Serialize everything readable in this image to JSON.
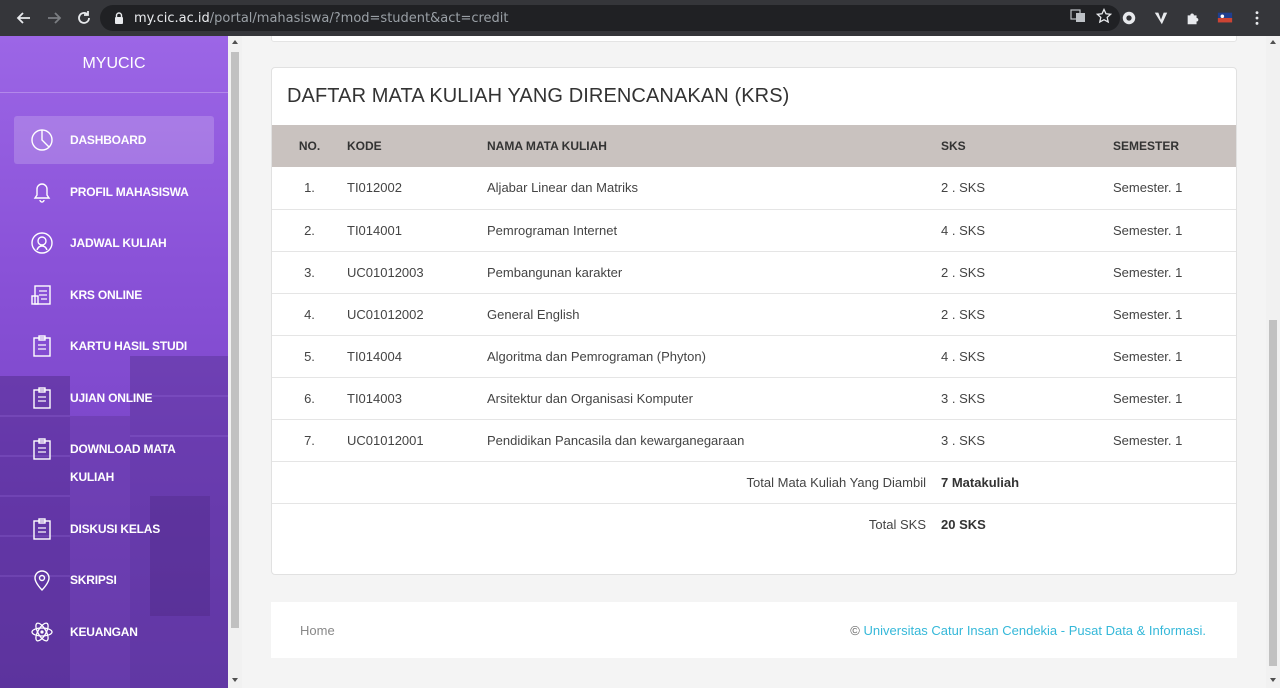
{
  "browser": {
    "url_host": "my.cic.ac.id",
    "url_path": "/portal/mahasiswa/?mod=student&act=credit"
  },
  "sidebar": {
    "brand": "MYUCIC",
    "items": [
      {
        "label": "DASHBOARD",
        "icon": "pie-chart-icon",
        "active": true
      },
      {
        "label": "PROFIL MAHASISWA",
        "icon": "bell-icon"
      },
      {
        "label": "JADWAL KULIAH",
        "icon": "user-circle-icon"
      },
      {
        "label": "KRS ONLINE",
        "icon": "document-icon"
      },
      {
        "label": "KARTU HASIL STUDI",
        "icon": "clipboard-icon"
      },
      {
        "label": "UJIAN ONLINE",
        "icon": "clipboard-icon"
      },
      {
        "label": "DOWNLOAD MATA KULIAH",
        "icon": "clipboard-icon"
      },
      {
        "label": "DISKUSI KELAS",
        "icon": "clipboard-icon"
      },
      {
        "label": "SKRIPSI",
        "icon": "map-pin-icon"
      },
      {
        "label": "KEUANGAN",
        "icon": "atom-icon"
      }
    ]
  },
  "main": {
    "title": "DAFTAR MATA KULIAH YANG DIRENCANAKAN (KRS)",
    "table": {
      "headers": [
        "NO.",
        "KODE",
        "NAMA MATA KULIAH",
        "SKS",
        "SEMESTER"
      ],
      "rows": [
        [
          "1.",
          "TI012002",
          "Aljabar Linear dan Matriks",
          "2 . SKS",
          "Semester. 1"
        ],
        [
          "2.",
          "TI014001",
          "Pemrograman Internet",
          "4 . SKS",
          "Semester. 1"
        ],
        [
          "3.",
          "UC01012003",
          "Pembangunan karakter",
          "2 . SKS",
          "Semester. 1"
        ],
        [
          "4.",
          "UC01012002",
          "General English",
          "2 . SKS",
          "Semester. 1"
        ],
        [
          "5.",
          "TI014004",
          "Algoritma dan Pemrograman (Phyton)",
          "4 . SKS",
          "Semester. 1"
        ],
        [
          "6.",
          "TI014003",
          "Arsitektur dan Organisasi Komputer",
          "3 . SKS",
          "Semester. 1"
        ],
        [
          "7.",
          "UC01012001",
          "Pendidikan Pancasila dan kewarganegaraan",
          "3 . SKS",
          "Semester. 1"
        ]
      ],
      "total_mk_label": "Total Mata Kuliah Yang Diambil",
      "total_mk_value": "7 Matakuliah",
      "total_sks_label": "Total SKS",
      "total_sks_value": "20 SKS"
    }
  },
  "footer": {
    "home": "Home",
    "copyright_symbol": "©",
    "copyright_link": "Universitas Catur Insan Cendekia - Pusat Data & Informasi."
  },
  "colors": {
    "sidebar_top": "#9c66e6",
    "sidebar_bottom": "#6e3fb8",
    "table_header": "#c9c2bf",
    "link": "#35b8d9"
  }
}
